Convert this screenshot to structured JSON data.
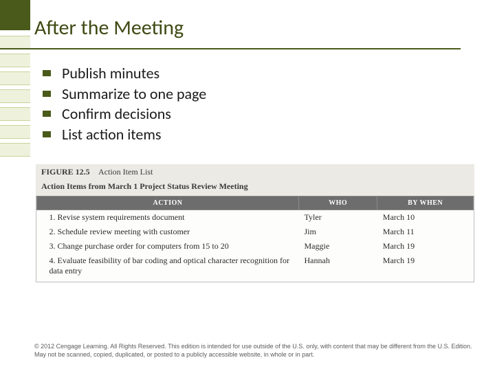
{
  "title": "After the Meeting",
  "bullets": [
    "Publish minutes",
    "Summarize to one page",
    "Confirm decisions",
    "List action items"
  ],
  "figure": {
    "label_num": "FIGURE 12.5",
    "label_title": "Action Item List",
    "subtitle": "Action Items from March 1 Project Status Review Meeting",
    "headers": {
      "action": "ACTION",
      "who": "WHO",
      "when": "BY WHEN"
    },
    "rows": [
      {
        "action": "1. Revise system requirements document",
        "who": "Tyler",
        "when": "March 10"
      },
      {
        "action": "2. Schedule review meeting with customer",
        "who": "Jim",
        "when": "March 11"
      },
      {
        "action": "3. Change purchase order for computers from 15 to 20",
        "who": "Maggie",
        "when": "March 19"
      },
      {
        "action": "4. Evaluate feasibility of bar coding and optical character recognition for data entry",
        "who": "Hannah",
        "when": "March 19"
      }
    ]
  },
  "copyright": "© 2012 Cengage Learning. All Rights Reserved. This edition is intended for use outside of the U.S. only, with content that may be different from the U.S. Edition. May not be scanned, copied, duplicated, or posted to a publicly accessible website, in whole or in part."
}
